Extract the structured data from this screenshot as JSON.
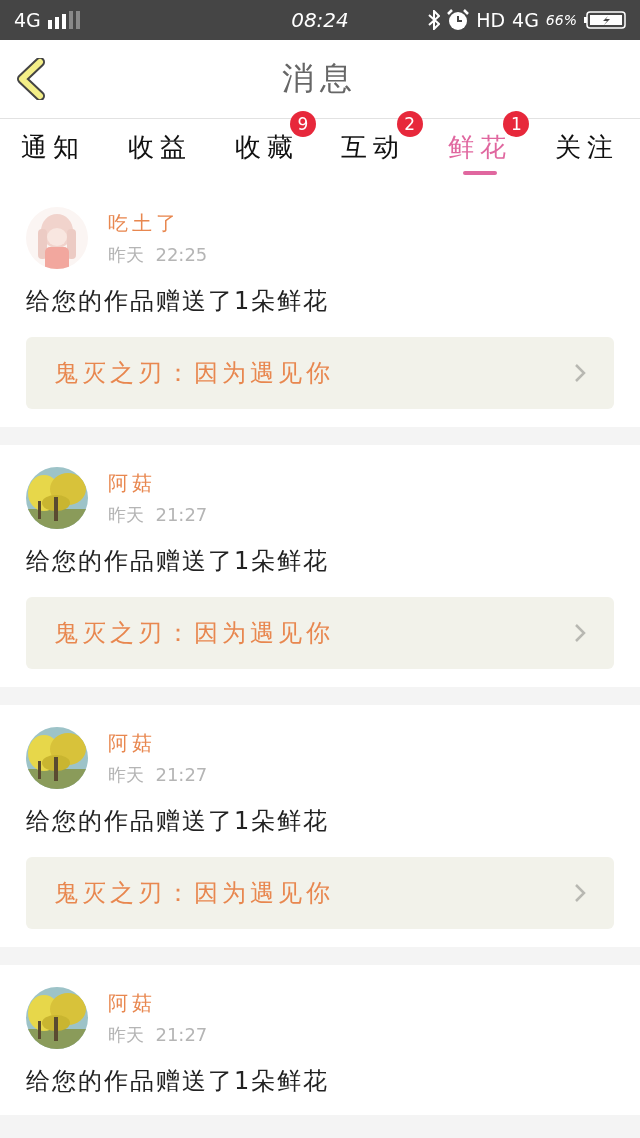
{
  "status_bar": {
    "network": "4G",
    "time": "08:24",
    "hd": "HD",
    "network_2": "4G",
    "battery": "66%"
  },
  "header": {
    "title": "消息"
  },
  "tabs": [
    {
      "label": "通知",
      "selected": false
    },
    {
      "label": "收益",
      "selected": false
    },
    {
      "label": "收藏",
      "selected": false,
      "badge": "9"
    },
    {
      "label": "互动",
      "selected": false,
      "badge": "2"
    },
    {
      "label": "鲜花",
      "selected": true,
      "badge": "1"
    },
    {
      "label": "关注",
      "selected": false
    }
  ],
  "messages": [
    {
      "name": "吃土了",
      "time": "昨天  22:25",
      "text": "给您的作品赠送了1朵鲜花",
      "work": "鬼灭之刃：因为遇见你"
    },
    {
      "name": "阿菇",
      "time": "昨天  21:27",
      "text": "给您的作品赠送了1朵鲜花",
      "work": "鬼灭之刃：因为遇见你"
    },
    {
      "name": "阿菇",
      "time": "昨天  21:27",
      "text": "给您的作品赠送了1朵鲜花",
      "work": "鬼灭之刃：因为遇见你"
    },
    {
      "name": "阿菇",
      "time": "昨天  21:27",
      "text": "给您的作品赠送了1朵鲜花"
    }
  ]
}
